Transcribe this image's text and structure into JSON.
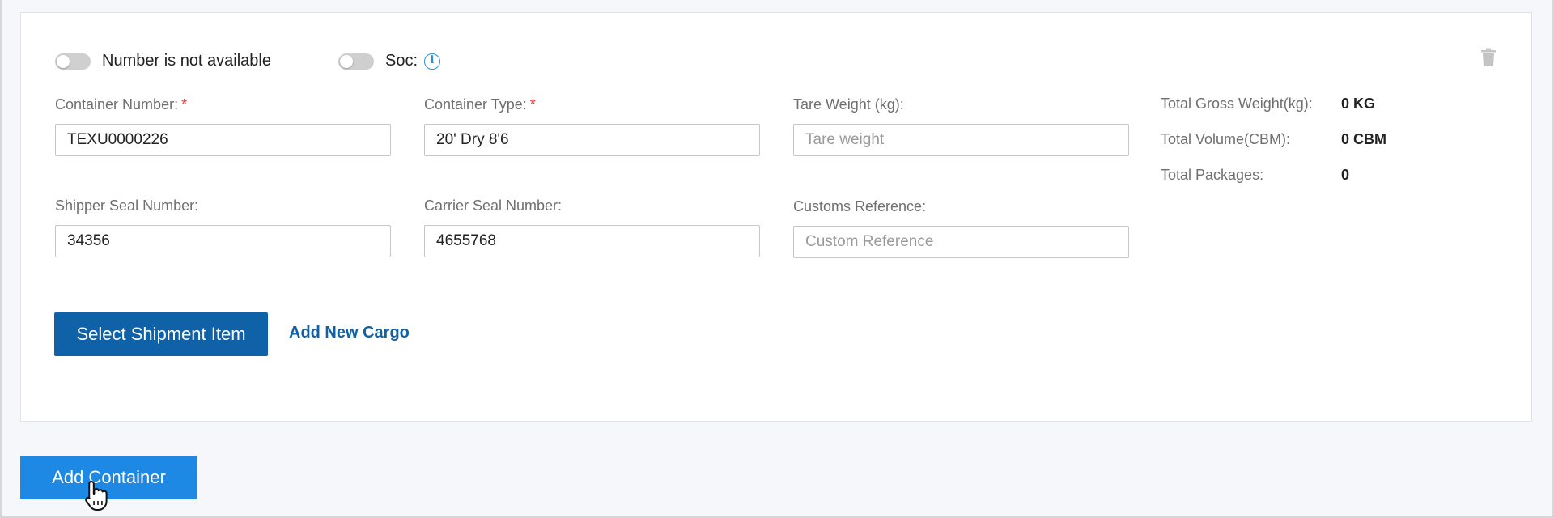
{
  "toggles": {
    "number_not_available": {
      "label": "Number is not available",
      "on": false
    },
    "soc": {
      "label": "Soc:",
      "on": false,
      "info_icon": "info-circle-icon"
    }
  },
  "icons": {
    "delete": "trash-icon",
    "cursor": "hand-pointer-icon"
  },
  "fields": {
    "container_number": {
      "label": "Container Number:",
      "required": "*",
      "value": "TEXU0000226",
      "placeholder": ""
    },
    "container_type": {
      "label": "Container Type:",
      "required": "*",
      "value": "20' Dry 8'6",
      "placeholder": ""
    },
    "tare_weight": {
      "label": "Tare Weight (kg):",
      "value": "",
      "placeholder": "Tare weight"
    },
    "shipper_seal_number": {
      "label": "Shipper Seal Number:",
      "value": "34356",
      "placeholder": ""
    },
    "carrier_seal_number": {
      "label": "Carrier Seal Number:",
      "value": "4655768",
      "placeholder": ""
    },
    "customs_reference": {
      "label": "Customs Reference:",
      "value": "",
      "placeholder": "Custom Reference"
    }
  },
  "totals": [
    {
      "label": "Total Gross Weight(kg):",
      "value": "0 KG"
    },
    {
      "label": "Total Volume(CBM):",
      "value": "0 CBM"
    },
    {
      "label": "Total Packages:",
      "value": "0"
    }
  ],
  "actions": {
    "select_shipment_item": "Select Shipment Item",
    "add_new_cargo": "Add New Cargo",
    "add_container": "Add Container"
  },
  "colors": {
    "primary_dark": "#0f62a7",
    "primary": "#1e88e5",
    "required": "#e53935",
    "info": "#2a8fd8"
  }
}
